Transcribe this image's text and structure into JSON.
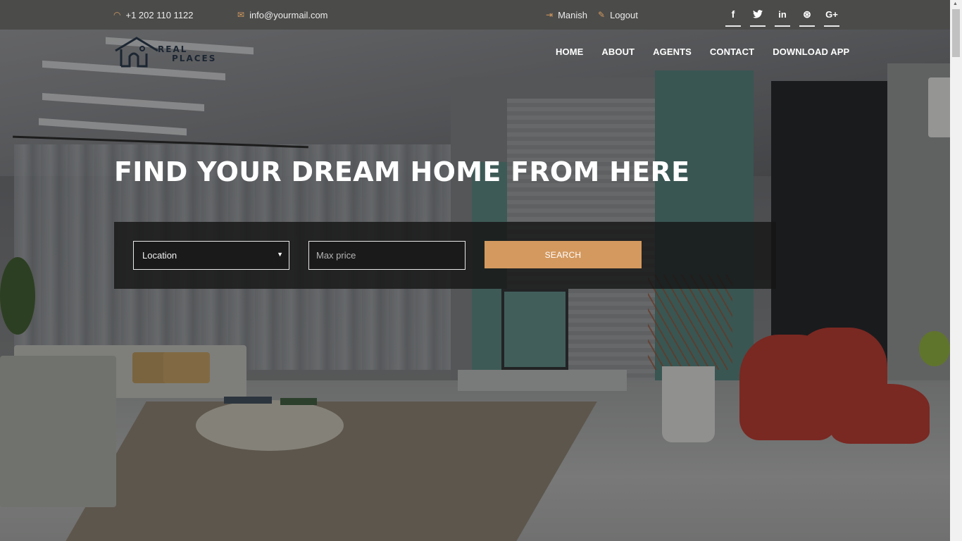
{
  "topbar": {
    "phone": "+1 202 110 1122",
    "phone_icon": "phone-icon",
    "email": "info@yourmail.com",
    "email_icon": "envelope-icon",
    "user_name": "Manish",
    "user_icon": "sign-in-icon",
    "logout_label": "Logout",
    "logout_icon": "pencil-icon",
    "social": [
      {
        "name": "facebook-icon",
        "glyph": "f"
      },
      {
        "name": "twitter-icon",
        "glyph": "🐦"
      },
      {
        "name": "linkedin-icon",
        "glyph": "in"
      },
      {
        "name": "dribbble-icon",
        "glyph": "⊛"
      },
      {
        "name": "google-plus-icon",
        "glyph": "G+"
      }
    ]
  },
  "header": {
    "logo_line1": "REAL",
    "logo_line2": "PLACES",
    "nav": [
      "HOME",
      "ABOUT",
      "AGENTS",
      "CONTACT",
      "DOWNLOAD APP"
    ]
  },
  "hero": {
    "headline": "FIND YOUR DREAM HOME FROM HERE",
    "location_value": "Location",
    "price_placeholder": "Max price",
    "search_label": "SEARCH"
  },
  "colors": {
    "accent": "#d4995f",
    "topbar_bg": "#4b4b4a",
    "panel_bg": "#161616"
  }
}
